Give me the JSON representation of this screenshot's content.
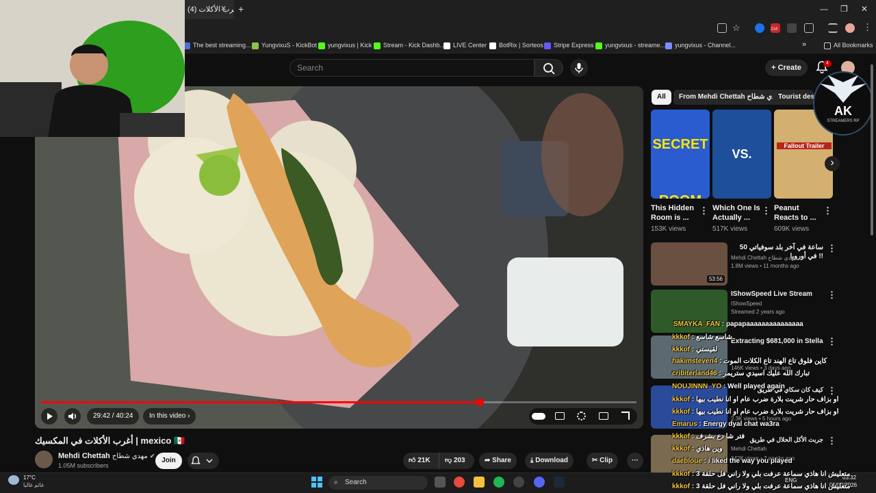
{
  "browser": {
    "tab_title": "(4) أغرب الأكلات",
    "new_tab": "+",
    "tab_close": "✕",
    "window_controls": [
      "—",
      "❐",
      "✕"
    ],
    "bookmarks": [
      {
        "label": "The best streaming...",
        "color": "#4a6fd8"
      },
      {
        "label": "YungvixuS - KickBot",
        "color": "#8bc34a"
      },
      {
        "label": "yungvixus | Kick",
        "color": "#53fc18"
      },
      {
        "label": "Stream - Kick Dashb...",
        "color": "#53fc18"
      },
      {
        "label": "LIVE Center",
        "color": "#ffffff"
      },
      {
        "label": "BotRix | Sorteos",
        "color": "#ffffff"
      },
      {
        "label": "Stripe Express",
        "color": "#635bff"
      },
      {
        "label": "yungvixus - streame...",
        "color": "#53fc18"
      },
      {
        "label": "yungvixus - Channel...",
        "color": "#7b8cff"
      }
    ],
    "bookmarks_more": "»",
    "all_bookmarks": "All Bookmarks",
    "ext_badge": "214"
  },
  "youtube": {
    "search_placeholder": "Search",
    "create_label": "Create",
    "notification_count": "4",
    "player": {
      "time": "29:42 / 40:24",
      "chapter": "In this video",
      "progress_fraction": 0.737
    },
    "video_title": "أغرب الأكلات في المكسيك | mexico 🇲🇽",
    "channel_name": "Mehdi Chettah",
    "channel_name_ar": "مهدي شطاح",
    "subscribers": "1.05M subscribers",
    "join_label": "Join",
    "likes": "21K",
    "dislikes": "203",
    "share_label": "Share",
    "download_label": "Download",
    "clip_label": "Clip",
    "chips": [
      {
        "label": "All",
        "active": true
      },
      {
        "label": "From Mehdi Chettah مهدي شطاح",
        "active": false
      },
      {
        "label": "Tourist des",
        "active": false
      }
    ],
    "shelf": [
      {
        "title": "This Hidden Room is ...",
        "views": "153K views",
        "thumb_text": "SECRET ROOM"
      },
      {
        "title": "Which One Is Actually ...",
        "views": "517K views",
        "thumb_text": "VS."
      },
      {
        "title": "Peanut Reacts to ...",
        "views": "609K views",
        "thumb_text": "Fallout Trailer"
      }
    ],
    "shelf_next": "›",
    "recommended": [
      {
        "title": "50 ساعة في آخر بلد سوفياتي في أوروبا !!",
        "channel": "Mehdi Chettah مهدي شطاح",
        "meta": "1.8M views • 11 months ago",
        "duration": "53:56",
        "color": "#6a5040"
      },
      {
        "title": "IShowSpeed Live Stream",
        "channel": "IShowSpeed",
        "meta": "Streamed 2 years ago",
        "duration": "",
        "color": "#2e5a2a"
      },
      {
        "title": "Extracting $681,000 in Stella",
        "channel": "",
        "meta": "146K views • 3 days ago",
        "duration": "",
        "color": "#5a6a70"
      },
      {
        "title": "كيف كان سكاي في طريق",
        "channel": "",
        "meta": "2.3K views • 5 hours ago",
        "duration": "",
        "color": "#2a4a9a"
      },
      {
        "title": "جربت الأكل الحلال في طريق",
        "channel": "Mehdi Chettah",
        "meta": "642K views • 2 weeks ago",
        "duration": "",
        "color": "#7a6a50"
      }
    ]
  },
  "overlay": {
    "logo_text": "AK",
    "logo_sub": "STREAMERS RP",
    "chat": [
      {
        "user": "SMAYKA_FAN",
        "text": "papapaaaaaaaaaaaaaaa"
      },
      {
        "user": "kkkof",
        "text": "شاسع شاسع"
      },
      {
        "user": "kkkof",
        "text": "لقيستي"
      },
      {
        "user": "hakimsteven4",
        "text": "كاين فلوق تاع الهند تاع الكلات الموت"
      },
      {
        "user": "cribiterland46",
        "text": "تبارك الله عليك اسيدي ستريمر"
      },
      {
        "user": "NOUJINNN_YO",
        "text": "Well played again"
      },
      {
        "user": "kkkof",
        "text": "أو بزاف حار شريت بلارة ضرب عام او انا نطيب بيها"
      },
      {
        "user": "kkkof",
        "text": "أو بزاف حار شريت بلارة ضرب عام او انا نطيب بيها"
      },
      {
        "user": "Emarus",
        "text": "Energy dyal chat wa3ra"
      },
      {
        "user": "kkkof",
        "text": "فتر شا دع بشرف"
      },
      {
        "user": "kkkof",
        "text": "وين هاذي"
      },
      {
        "user": "daebloue",
        "text": "i liked the way you played"
      },
      {
        "user": "kkkof",
        "text": "متعليش انا هاذي سماعة عرفت بلي ولا راني فل حلقة 3"
      },
      {
        "user": "kkkof",
        "text": "متعليش انا هاذي سماعة عرفت بلي ولا راني فل حلقة 3"
      }
    ]
  },
  "taskbar": {
    "weather_temp": "17°C",
    "weather_desc": "غائم غالبا",
    "search_label": "Search",
    "lang": "ENG",
    "time": "03:32",
    "date": "05/02/2026"
  }
}
